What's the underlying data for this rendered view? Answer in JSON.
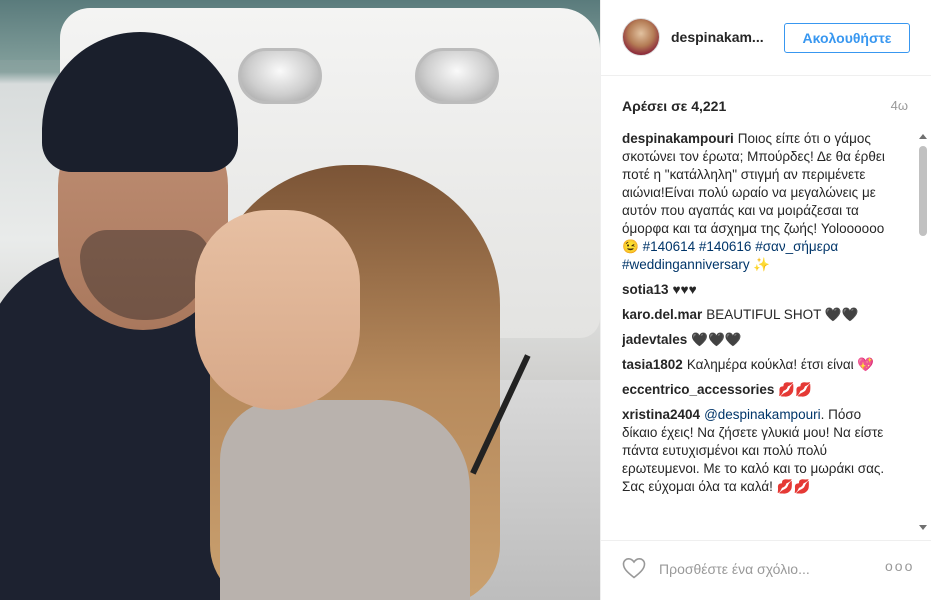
{
  "post": {
    "image_alt": "",
    "username": "despinakam...",
    "follow_label": "Ακολουθήστε",
    "likes_label": "Αρέσει σε 4,221",
    "age": "4ω",
    "caption": {
      "user": "despinakampouri",
      "text": "Ποιος είπε ότι ο γάμος σκοτώνει τον έρωτα; Μπούρδες! Δε θα έρθει ποτέ η \"κατάλληλη\" στιγμή αν περιμένετε αιώνια!Είναι πολύ ωραίο να μεγαλώνεις με αυτόν που αγαπάς και να μοιράζεσαι τα όμορφα και τα άσχημα της ζωής! Yolοοοοοο 😉",
      "tags": "#140614 #140616 #σαν_σήμερα #weddinganniversary ✨"
    },
    "comments": [
      {
        "user": "sotia13",
        "text": "♥♥♥"
      },
      {
        "user": "karo.del.mar",
        "text": "BEAUTIFUL SHOT 🖤🖤"
      },
      {
        "user": "jadevtales",
        "text": "🖤🖤🖤"
      },
      {
        "user": "tasia1802",
        "text": "Καλημέρα κούκλα! έτσι είναι 💖"
      },
      {
        "user": "eccentrico_accessories",
        "text": "💋💋"
      },
      {
        "user": "xristina2404",
        "mention": "@despinakampouri",
        "text": ". Πόσο δίκαιο έχεις! Να ζήσετε γλυκιά μου! Να είστε πάντα ευτυχισμένοι και πολύ πολύ ερωτευμενοι. Με το καλό και το μωράκι σας. Σας εύχομαι όλα τα καλά! 💋💋"
      }
    ],
    "comment_placeholder": "Προσθέστε ένα σχόλιο...",
    "more_label": "ooo"
  },
  "icons": {
    "heart": "heart-outline-icon",
    "more": "ellipsis-icon"
  }
}
